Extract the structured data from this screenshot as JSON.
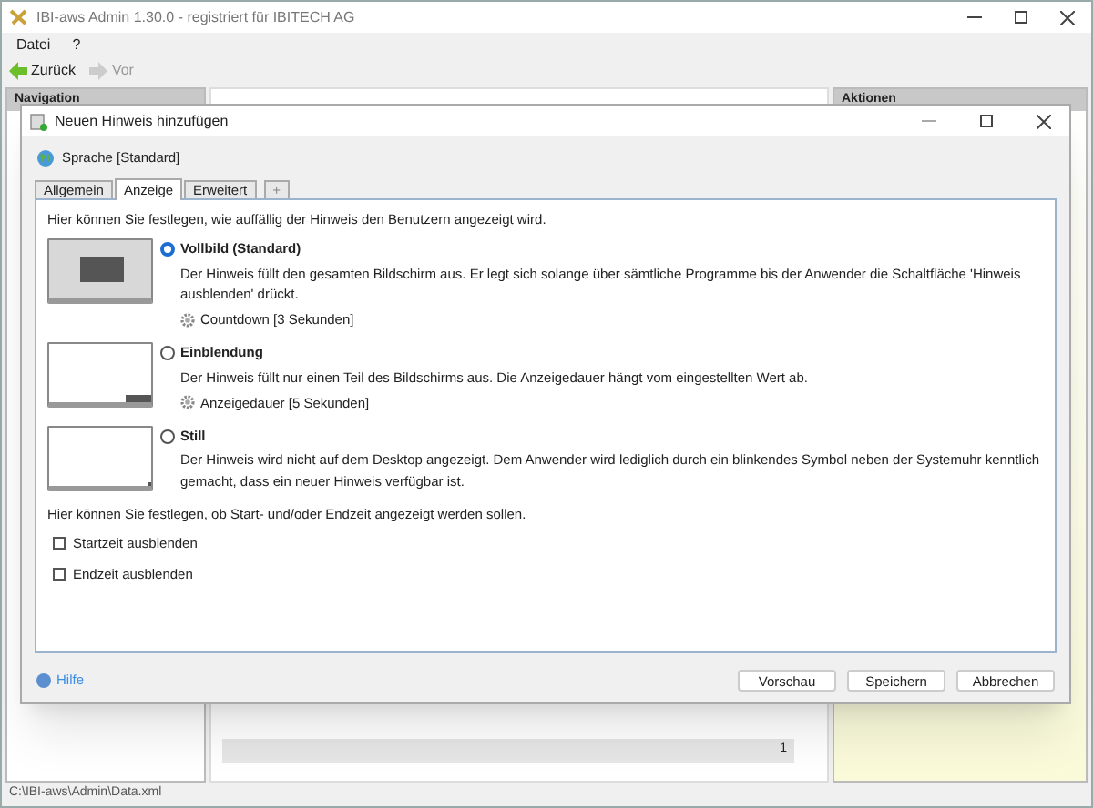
{
  "window": {
    "title": "IBI-aws Admin 1.30.0 - registriert für IBITECH AG"
  },
  "menu": [
    "Datei",
    "?"
  ],
  "toolbar": [
    {
      "label": "Zurück",
      "disabled": false
    },
    {
      "label": "Vor",
      "disabled": true
    }
  ],
  "navigation": {
    "title": "Navigation"
  },
  "actions": {
    "title": "Aktionen"
  },
  "table_footer": {
    "count": "1"
  },
  "status_bar": "C:\\IBI-aws\\Admin\\Data.xml",
  "dialog": {
    "title": "Neuen Hinweis hinzufügen",
    "language": "Sprache [Standard]",
    "tabs": [
      {
        "label": "Allgemein",
        "selected": false
      },
      {
        "label": "Anzeige",
        "selected": true
      },
      {
        "label": "Erweitert",
        "selected": false
      },
      {
        "label": "+",
        "selected": false
      }
    ],
    "intro": "Hier können Sie festlegen, wie auffällig der Hinweis den Benutzern angezeigt wird.",
    "options": [
      {
        "kind": "fullscreen",
        "title": "Vollbild (Standard)",
        "selected": true,
        "description": "Der Hinweis füllt den gesamten Bildschirm aus. Er legt sich solange über sämtliche Programme bis der Anwender die Schaltfläche 'Hinweis ausblenden' drückt.",
        "setting": "Countdown [3 Sekunden]"
      },
      {
        "kind": "corner",
        "title": "Einblendung",
        "selected": false,
        "description": "Der Hinweis füllt nur einen Teil des Bildschirms aus. Die Anzeigedauer hängt vom eingestellten Wert ab.",
        "setting": "Anzeigedauer [5 Sekunden]"
      },
      {
        "kind": "tray",
        "title": "Still",
        "selected": false,
        "description": "Der Hinweis wird nicht auf dem Desktop angezeigt. Dem Anwender wird lediglich durch ein blinkendes Symbol neben der Systemuhr kenntlich gemacht, dass ein neuer Hinweis verfügbar ist."
      }
    ],
    "time_intro": "Hier können Sie festlegen, ob Start- und/oder Endzeit angezeigt werden sollen.",
    "checkboxes": [
      {
        "label": "Startzeit ausblenden",
        "checked": false
      },
      {
        "label": "Endzeit ausblenden",
        "checked": false
      }
    ],
    "help": "Hilfe",
    "buttons": [
      "Vorschau",
      "Speichern",
      "Abbrechen"
    ]
  }
}
